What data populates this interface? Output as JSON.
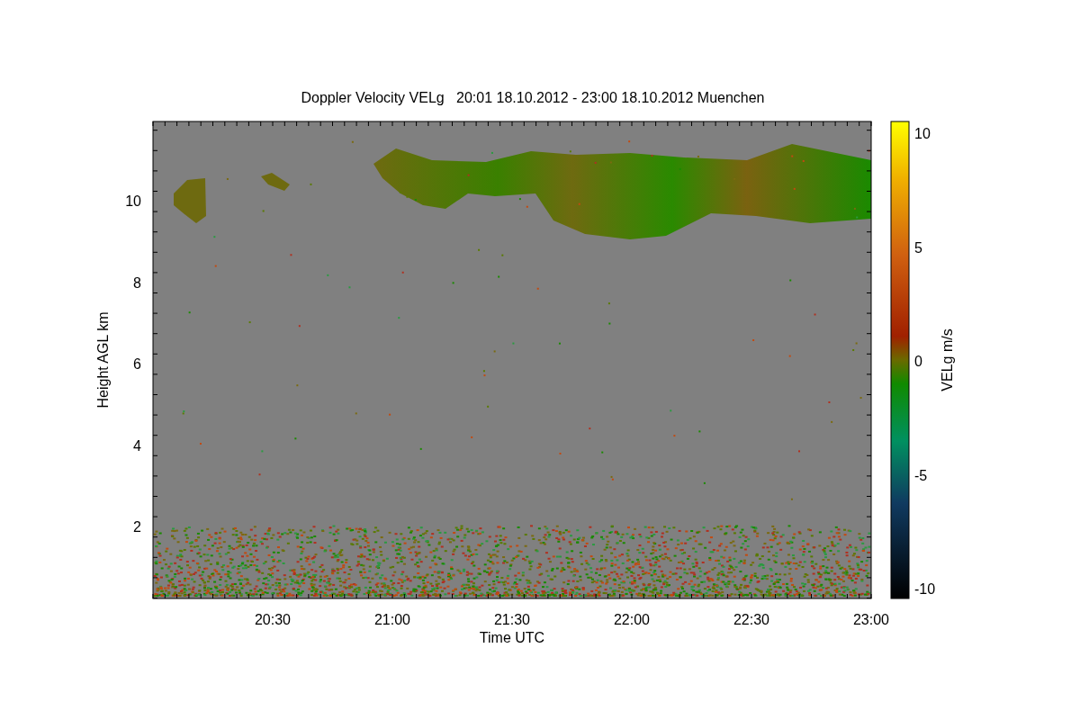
{
  "title": "Doppler Velocity VELg   20:01 18.10.2012 - 23:00 18.10.2012 Muenchen",
  "x_axis": {
    "label": "Time UTC",
    "ticks": [
      "20:30",
      "21:00",
      "21:30",
      "22:00",
      "22:30",
      "23:00"
    ]
  },
  "y_axis": {
    "label": "Height AGL km",
    "ticks": [
      "10",
      "8",
      "6",
      "4",
      "2"
    ]
  },
  "colorbar": {
    "label": "VELg m/s",
    "ticks": [
      "10",
      "5",
      "0",
      "-5",
      "-10"
    ]
  }
}
